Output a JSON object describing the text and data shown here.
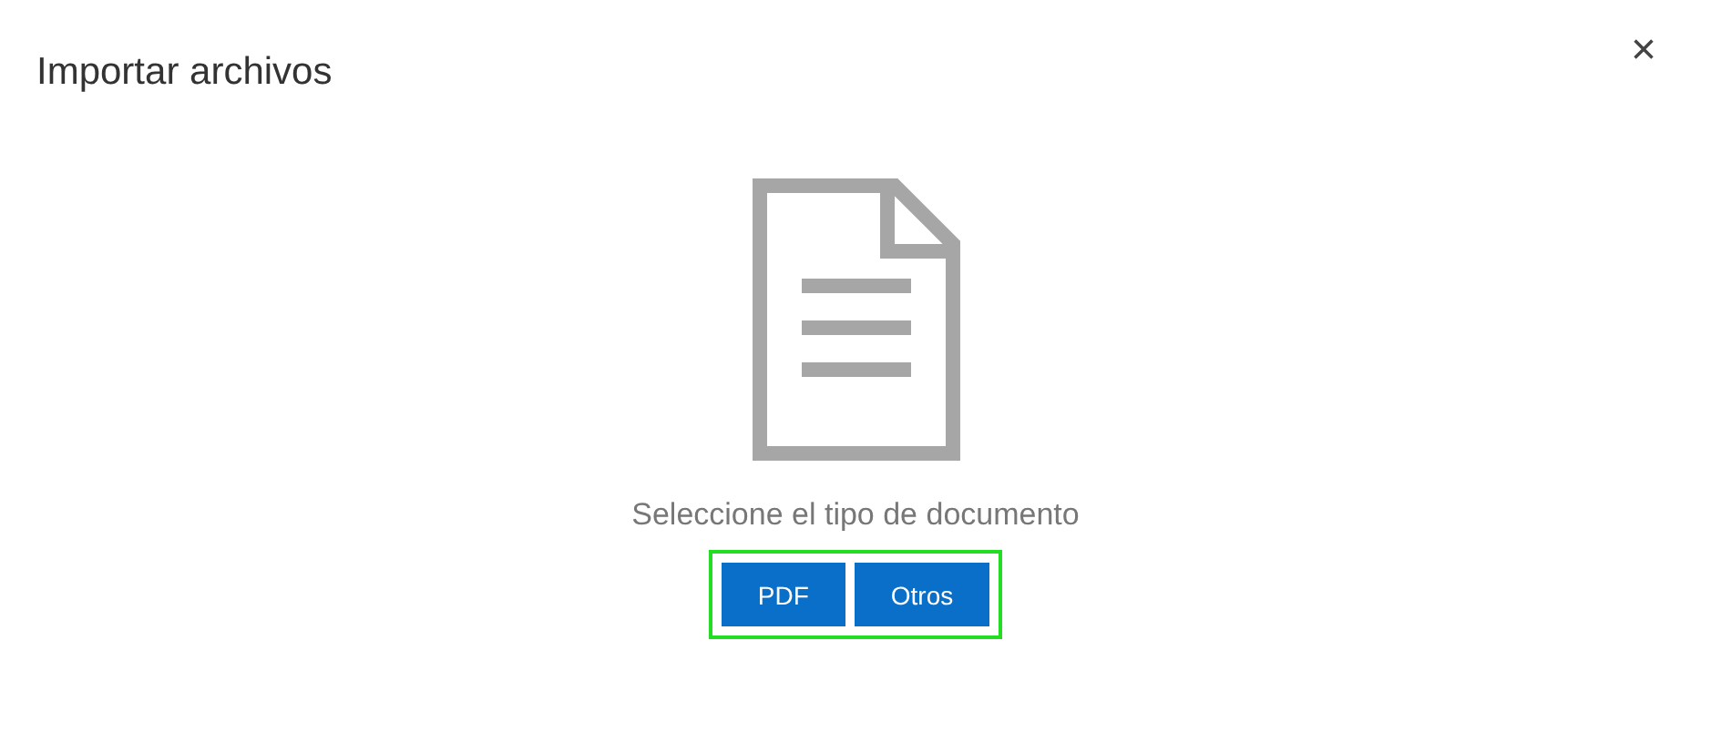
{
  "dialog": {
    "title": "Importar archivos",
    "close": "×"
  },
  "prompt": "Seleccione el tipo de documento",
  "buttons": [
    {
      "label": "PDF"
    },
    {
      "label": "Otros"
    }
  ]
}
